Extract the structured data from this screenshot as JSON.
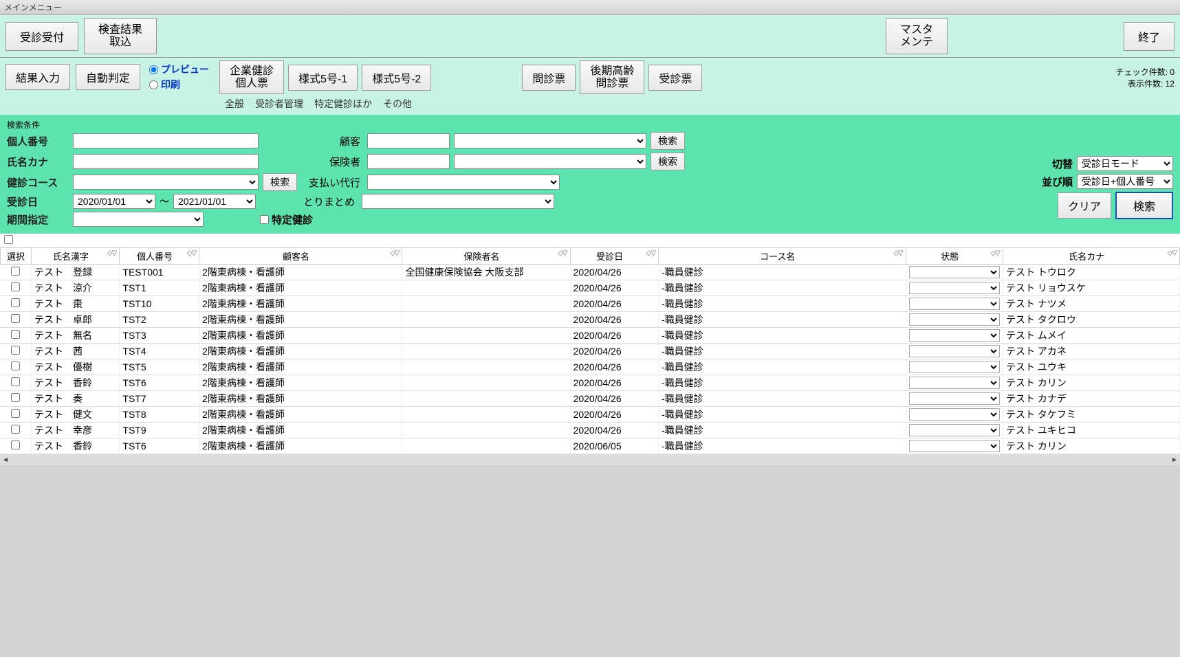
{
  "window": {
    "title": "メインメニュー"
  },
  "topbar": {
    "reception": "受診受付",
    "import": "検査結果\n取込",
    "master": "マスタ\nメンテ",
    "exit": "終了"
  },
  "ribbon": {
    "result_entry": "結果入力",
    "auto_judge": "自動判定",
    "radio_preview": "プレビュー",
    "radio_print": "印刷",
    "btn_company": "企業健診\n個人票",
    "btn_form5_1": "様式5号-1",
    "btn_form5_2": "様式5号-2",
    "btn_monshin": "問診票",
    "btn_kouki": "後期高齢\n問診票",
    "btn_jushin": "受診票",
    "subtabs": [
      "全般",
      "受診者管理",
      "特定健診ほか",
      "その他"
    ],
    "counts": {
      "check": "チェック件数: 0",
      "disp": "表示件数: 12"
    }
  },
  "search": {
    "legend": "検索条件",
    "labels": {
      "pno": "個人番号",
      "kana": "氏名カナ",
      "course": "健診コース",
      "date": "受診日",
      "period": "期間指定",
      "client": "顧客",
      "insurer": "保険者",
      "payproxy": "支払い代行",
      "summary": "とりまとめ",
      "tokutei": "特定健診",
      "tilde": "～",
      "search_btn": "検索"
    },
    "date_from": "2020/01/01",
    "date_to": "2021/01/01",
    "right": {
      "kirikae_label": "切替",
      "kirikae_value": "受診日モード",
      "narabi_label": "並び順",
      "narabi_value": "受診日+個人番号",
      "clear": "クリア",
      "search": "検索"
    }
  },
  "grid": {
    "headers": {
      "select": "選択",
      "kanji": "氏名漢字",
      "pno": "個人番号",
      "client": "顧客名",
      "insurer": "保険者名",
      "date": "受診日",
      "course": "コース名",
      "state": "状態",
      "kana": "氏名カナ"
    },
    "rows": [
      {
        "kanji": "テスト　登録",
        "pno": "TEST001",
        "client": "2階東病棟・看護師",
        "insurer": "全国健康保険協会 大阪支部",
        "date": "2020/04/26",
        "course": "-職員健診",
        "kana": "テスト トウロク"
      },
      {
        "kanji": "テスト　涼介",
        "pno": "TST1",
        "client": "2階東病棟・看護師",
        "insurer": "",
        "date": "2020/04/26",
        "course": "-職員健診",
        "kana": "テスト リョウスケ"
      },
      {
        "kanji": "テスト　棗",
        "pno": "TST10",
        "client": "2階東病棟・看護師",
        "insurer": "",
        "date": "2020/04/26",
        "course": "-職員健診",
        "kana": "テスト ナツメ"
      },
      {
        "kanji": "テスト　卓郎",
        "pno": "TST2",
        "client": "2階東病棟・看護師",
        "insurer": "",
        "date": "2020/04/26",
        "course": "-職員健診",
        "kana": "テスト タクロウ"
      },
      {
        "kanji": "テスト　無名",
        "pno": "TST3",
        "client": "2階東病棟・看護師",
        "insurer": "",
        "date": "2020/04/26",
        "course": "-職員健診",
        "kana": "テスト ムメイ"
      },
      {
        "kanji": "テスト　茜",
        "pno": "TST4",
        "client": "2階東病棟・看護師",
        "insurer": "",
        "date": "2020/04/26",
        "course": "-職員健診",
        "kana": "テスト アカネ"
      },
      {
        "kanji": "テスト　優樹",
        "pno": "TST5",
        "client": "2階東病棟・看護師",
        "insurer": "",
        "date": "2020/04/26",
        "course": "-職員健診",
        "kana": "テスト ユウキ"
      },
      {
        "kanji": "テスト　香鈴",
        "pno": "TST6",
        "client": "2階東病棟・看護師",
        "insurer": "",
        "date": "2020/04/26",
        "course": "-職員健診",
        "kana": "テスト カリン"
      },
      {
        "kanji": "テスト　奏",
        "pno": "TST7",
        "client": "2階東病棟・看護師",
        "insurer": "",
        "date": "2020/04/26",
        "course": "-職員健診",
        "kana": "テスト カナデ"
      },
      {
        "kanji": "テスト　健文",
        "pno": "TST8",
        "client": "2階東病棟・看護師",
        "insurer": "",
        "date": "2020/04/26",
        "course": "-職員健診",
        "kana": "テスト タケフミ"
      },
      {
        "kanji": "テスト　幸彦",
        "pno": "TST9",
        "client": "2階東病棟・看護師",
        "insurer": "",
        "date": "2020/04/26",
        "course": "-職員健診",
        "kana": "テスト ユキヒコ"
      },
      {
        "kanji": "テスト　香鈴",
        "pno": "TST6",
        "client": "2階東病棟・看護師",
        "insurer": "",
        "date": "2020/06/05",
        "course": "-職員健診",
        "kana": "テスト カリン"
      }
    ]
  }
}
